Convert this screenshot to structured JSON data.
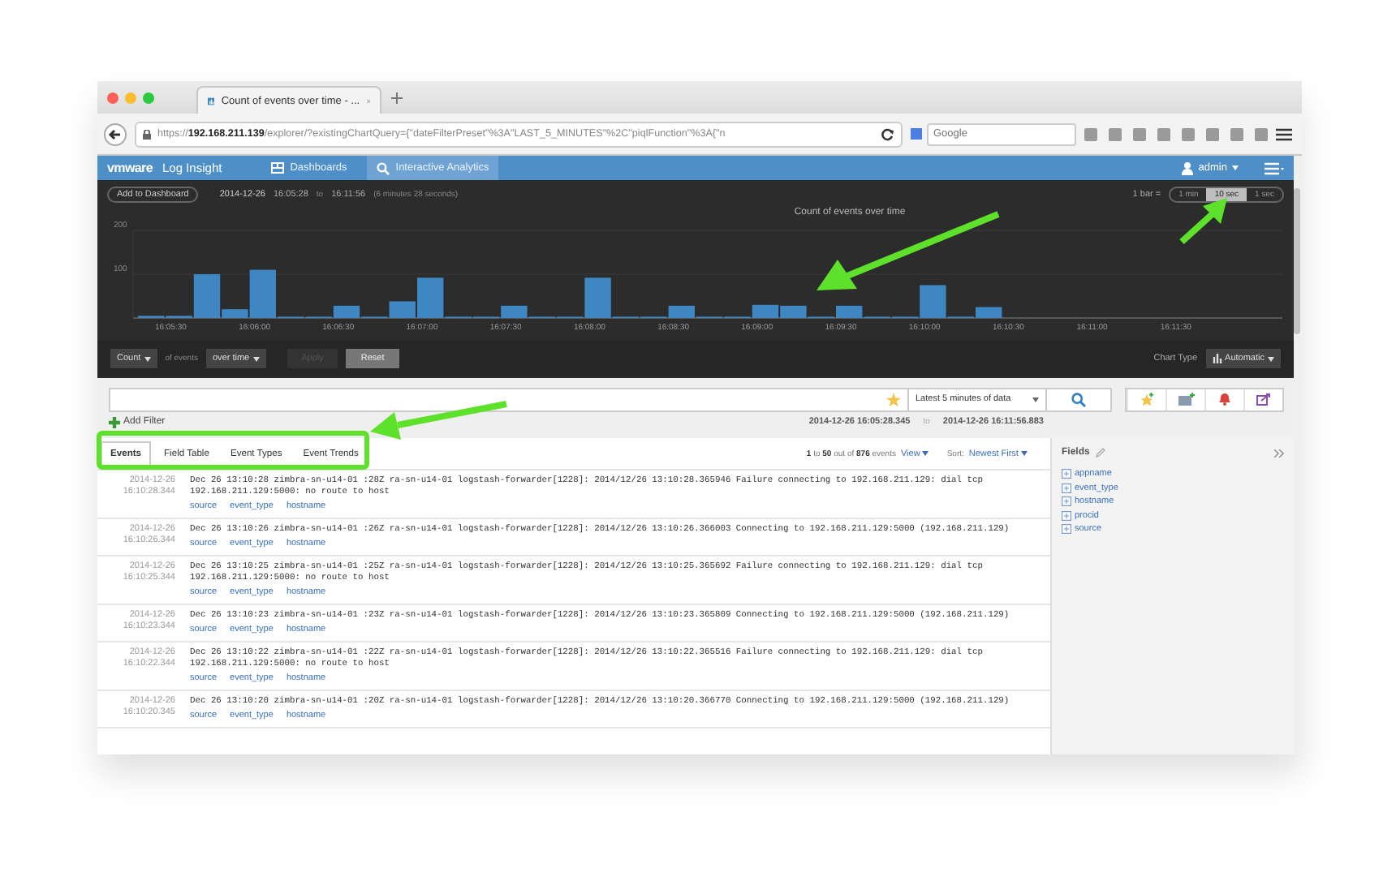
{
  "browser": {
    "tab_title": "Count of events over time - ...",
    "url": "https://**192.168.211.139**/explorer/?existingChartQuery={\"dateFilterPreset\"%3A\"LAST_5_MINUTES\"%2C\"piqlFunction\"%3A{\"n",
    "search_placeholder": "Google"
  },
  "app": {
    "logo": "vmware",
    "product": "Log Insight",
    "user": "admin",
    "nav": [
      {
        "label": "Dashboards",
        "selected": false
      },
      {
        "label": "Interactive Analytics",
        "selected": true
      }
    ]
  },
  "header": {
    "add_button": "Add to Dashboard",
    "start": "2014-12-26",
    "start_time": "16:05:28",
    "to": "to",
    "end": "16:11:56",
    "duration": "(6 minutes 28 seconds)",
    "bar_label": "1 bar =",
    "bar_sizes": [
      {
        "label": "1 min",
        "selected": false
      },
      {
        "label": "10 sec",
        "selected": true
      },
      {
        "label": "1 sec",
        "selected": false
      }
    ]
  },
  "chart": {
    "chart_data": {
      "type": "bar",
      "title": "Count of events over time",
      "categories": [
        null,
        "16:05:30",
        null,
        null,
        "16:06:00",
        null,
        null,
        "16:06:30",
        null,
        null,
        "16:07:00",
        null,
        null,
        "16:07:30",
        null,
        null,
        "16:08:00",
        null,
        null,
        "16:08:30",
        null,
        null,
        "16:09:00",
        null,
        null,
        "16:09:30",
        null,
        null,
        "16:10:00",
        null,
        null,
        "16:10:30",
        null,
        null,
        "16:11:00",
        null,
        null,
        "16:11:30",
        null,
        null,
        null
      ],
      "values": [
        5,
        5,
        100,
        20,
        110,
        3,
        3,
        28,
        3,
        38,
        92,
        3,
        3,
        28,
        3,
        3,
        92,
        3,
        3,
        28,
        3,
        3,
        30,
        28,
        3,
        28,
        3,
        3,
        75,
        3,
        25,
        null,
        null,
        null,
        null,
        null,
        null,
        null,
        null,
        null,
        null
      ],
      "ylim": [
        0,
        200
      ],
      "yticks": [
        100,
        200
      ]
    }
  },
  "controls": {
    "function": "Count",
    "of": "of events",
    "grouping": "over time",
    "apply": {
      "label": "Apply",
      "disabled": true
    },
    "reset": {
      "label": "Reset",
      "disabled": false
    },
    "chart_type_label": "Chart Type",
    "chart_type": "Automatic"
  },
  "search": {
    "time_range": "Latest 5 minutes of data",
    "add_filter": "Add Filter",
    "range_start": "2014-12-26 16:05:28.345",
    "to": "to",
    "range_end": "2014-12-26 16:11:56.883"
  },
  "tabs": [
    {
      "label": "Events",
      "selected": true
    },
    {
      "label": "Field Table",
      "selected": false
    },
    {
      "label": "Event Types",
      "selected": false
    },
    {
      "label": "Event Trends",
      "selected": false
    }
  ],
  "results": {
    "count": "**1** to **50** out of **876** events",
    "view": "View",
    "sort_label": "Sort:",
    "sort": "Newest First"
  },
  "events": [
    {
      "date": "2014-12-26",
      "time": "16:10:28.344",
      "message": "Dec 26 13:10:28 zimbra-sn-u14-01 :28Z ra-sn-u14-01 logstash-forwarder[1228]: 2014/12/26 13:10:28.365946 Failure connecting to 192.168.211.129: dial tcp 192.168.211.129:5000: no route to host",
      "fields": [
        "source",
        "event_type",
        "hostname"
      ]
    },
    {
      "date": "2014-12-26",
      "time": "16:10:26.344",
      "message": "Dec 26 13:10:26 zimbra-sn-u14-01 :26Z ra-sn-u14-01 logstash-forwarder[1228]: 2014/12/26 13:10:26.366003 Connecting to 192.168.211.129:5000 (192.168.211.129)",
      "fields": [
        "source",
        "event_type",
        "hostname"
      ]
    },
    {
      "date": "2014-12-26",
      "time": "16:10:25.344",
      "message": "Dec 26 13:10:25 zimbra-sn-u14-01 :25Z ra-sn-u14-01 logstash-forwarder[1228]: 2014/12/26 13:10:25.365692 Failure connecting to 192.168.211.129: dial tcp 192.168.211.129:5000: no route to host",
      "fields": [
        "source",
        "event_type",
        "hostname"
      ]
    },
    {
      "date": "2014-12-26",
      "time": "16:10:23.344",
      "message": "Dec 26 13:10:23 zimbra-sn-u14-01 :23Z ra-sn-u14-01 logstash-forwarder[1228]: 2014/12/26 13:10:23.365809 Connecting to 192.168.211.129:5000 (192.168.211.129)",
      "fields": [
        "source",
        "event_type",
        "hostname"
      ]
    },
    {
      "date": "2014-12-26",
      "time": "16:10:22.344",
      "message": "Dec 26 13:10:22 zimbra-sn-u14-01 :22Z ra-sn-u14-01 logstash-forwarder[1228]: 2014/12/26 13:10:22.365516 Failure connecting to 192.168.211.129: dial tcp 192.168.211.129:5000: no route to host",
      "fields": [
        "source",
        "event_type",
        "hostname"
      ]
    },
    {
      "date": "2014-12-26",
      "time": "16:10:20.345",
      "message": "Dec 26 13:10:20 zimbra-sn-u14-01 :20Z ra-sn-u14-01 logstash-forwarder[1228]: 2014/12/26 13:10:20.366770 Connecting to 192.168.211.129:5000 (192.168.211.129)",
      "fields": [
        "source",
        "event_type",
        "hostname"
      ]
    }
  ],
  "fields_panel": {
    "title": "Fields",
    "items": [
      "appname",
      "event_type",
      "hostname",
      "procid",
      "source"
    ]
  }
}
